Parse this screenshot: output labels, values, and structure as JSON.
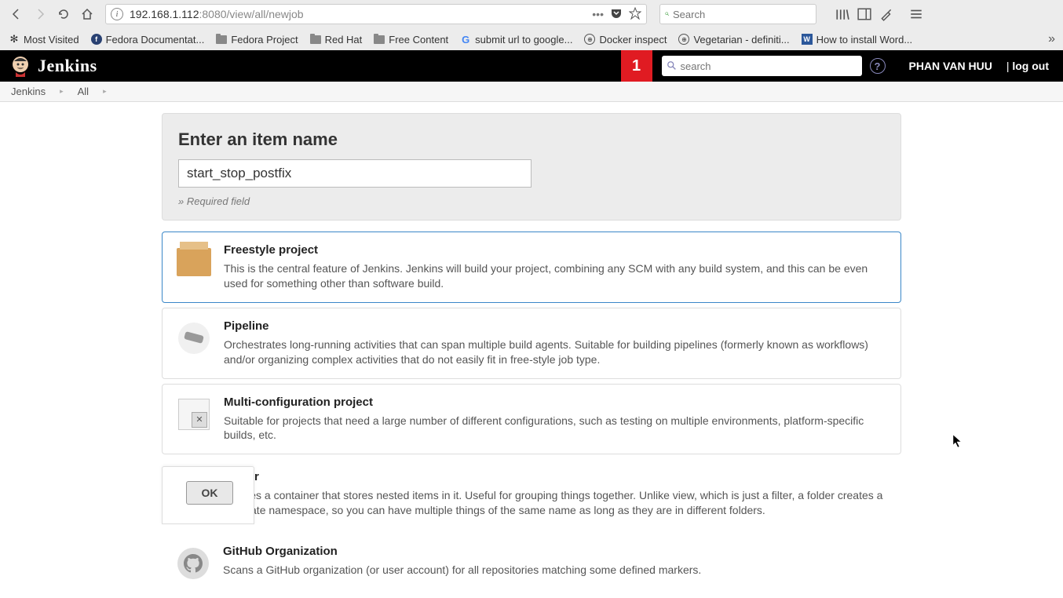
{
  "browser": {
    "url_host": "192.168.1.112",
    "url_port_path": ":8080/view/all/newjob",
    "search_placeholder": "Search"
  },
  "bookmarks": [
    {
      "label": "Most Visited",
      "icon": "gear"
    },
    {
      "label": "Fedora Documentat...",
      "icon": "fedora"
    },
    {
      "label": "Fedora Project",
      "icon": "folder"
    },
    {
      "label": "Red Hat",
      "icon": "folder"
    },
    {
      "label": "Free Content",
      "icon": "folder"
    },
    {
      "label": "submit url to google...",
      "icon": "google"
    },
    {
      "label": "Docker inspect",
      "icon": "globe"
    },
    {
      "label": "Vegetarian - definiti...",
      "icon": "globe"
    },
    {
      "label": "How to install Word...",
      "icon": "w"
    }
  ],
  "jenkins": {
    "title": "Jenkins",
    "notif_count": "1",
    "search_placeholder": "search",
    "user": "PHAN VAN HUU",
    "logout": "log out"
  },
  "breadcrumb": [
    {
      "label": "Jenkins"
    },
    {
      "label": "All"
    }
  ],
  "form": {
    "title": "Enter an item name",
    "value": "start_stop_postfix",
    "required": "» Required field"
  },
  "job_types": [
    {
      "name": "Freestyle project",
      "desc": "This is the central feature of Jenkins. Jenkins will build your project, combining any SCM with any build system, and this can be even used for something other than software build.",
      "selected": true
    },
    {
      "name": "Pipeline",
      "desc": "Orchestrates long-running activities that can span multiple build agents. Suitable for building pipelines (formerly known as workflows) and/or organizing complex activities that do not easily fit in free-style job type.",
      "selected": false
    },
    {
      "name": "Multi-configuration project",
      "desc": "Suitable for projects that need a large number of different configurations, such as testing on multiple environments, platform-specific builds, etc.",
      "selected": false
    },
    {
      "name": "Folder",
      "desc": "Creates a container that stores nested items in it. Useful for grouping things together. Unlike view, which is just a filter, a folder creates a separate namespace, so you can have multiple things of the same name as long as they are in different folders.",
      "selected": false
    },
    {
      "name": "GitHub Organization",
      "desc": "Scans a GitHub organization (or user account) for all repositories matching some defined markers.",
      "selected": false
    }
  ],
  "ok_button": "OK"
}
